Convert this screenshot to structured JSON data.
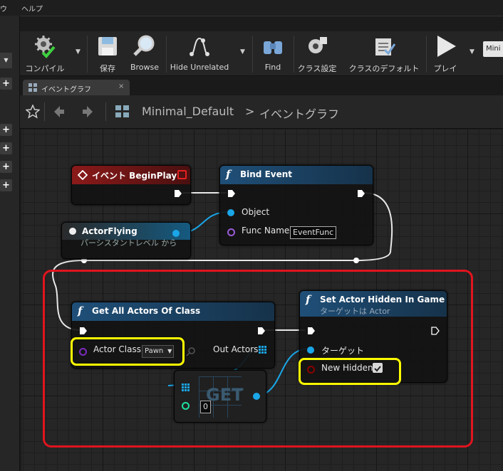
{
  "menu": {
    "item_left": "ウ",
    "item_help": "ヘルプ"
  },
  "toolbar": {
    "compile": "コンパイル",
    "save": "保存",
    "browse": "Browse",
    "hide_unrelated": "Hide Unrelated",
    "find": "Find",
    "class_settings": "クラス設定",
    "class_defaults": "クラスのデフォルト",
    "play": "プレイ",
    "mini_select": "Mini"
  },
  "tab": {
    "label": "イベントグラフ",
    "close": "×"
  },
  "breadcrumb": {
    "root": "Minimal_Default",
    "separator": ">",
    "current": "イベントグラフ"
  },
  "nodes": {
    "begin_play": {
      "title": "イベント BeginPlay"
    },
    "bind_event": {
      "title": "Bind Event",
      "pin_object": "Object",
      "pin_func_name": "Func Name",
      "func_name_value": "EventFunc"
    },
    "actor_flying": {
      "title": "ActorFlying",
      "subtitle": "パーシスタントレベル から"
    },
    "get_all_actors": {
      "title": "Get All Actors Of Class",
      "pin_actor_class": "Actor Class",
      "actor_class_value": "Pawn",
      "pin_out_actors": "Out Actors"
    },
    "set_hidden": {
      "title": "Set Actor Hidden In Game",
      "subtitle": "ターゲットは Actor",
      "pin_target": "ターゲット",
      "pin_new_hidden": "New Hidden",
      "new_hidden_checked": true
    },
    "get": {
      "title": "GET",
      "index_value": "0"
    }
  },
  "colors": {
    "event_header": "#8b1a1a",
    "function_header": "#1f4f78",
    "object_pin": "#1aa6e8",
    "class_pin": "#7a2dbd",
    "bool_pin": "#8b0000",
    "int_pin": "#1fe0a0",
    "highlight_red": "#e0141e",
    "highlight_yellow": "#ffff00"
  }
}
